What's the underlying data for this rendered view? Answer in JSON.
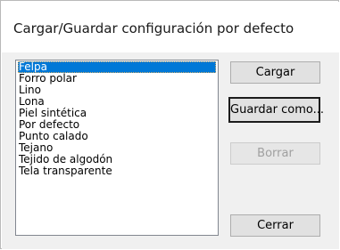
{
  "window": {
    "title": "Cargar/Guardar configuración por defecto"
  },
  "list": {
    "items": [
      "Felpa",
      "Forro polar",
      "Lino",
      "Lona",
      "Piel sintética",
      "Por defecto",
      "Punto calado",
      "Tejano",
      "Tejido de algodón",
      "Tela transparente"
    ],
    "selected": "Felpa"
  },
  "buttons": {
    "load": "Cargar",
    "save_as": "Guardar como...",
    "delete": "Borrar",
    "close": "Cerrar"
  },
  "colors": {
    "selection": "#0078d7",
    "disabled_text": "#a0a0a0"
  }
}
